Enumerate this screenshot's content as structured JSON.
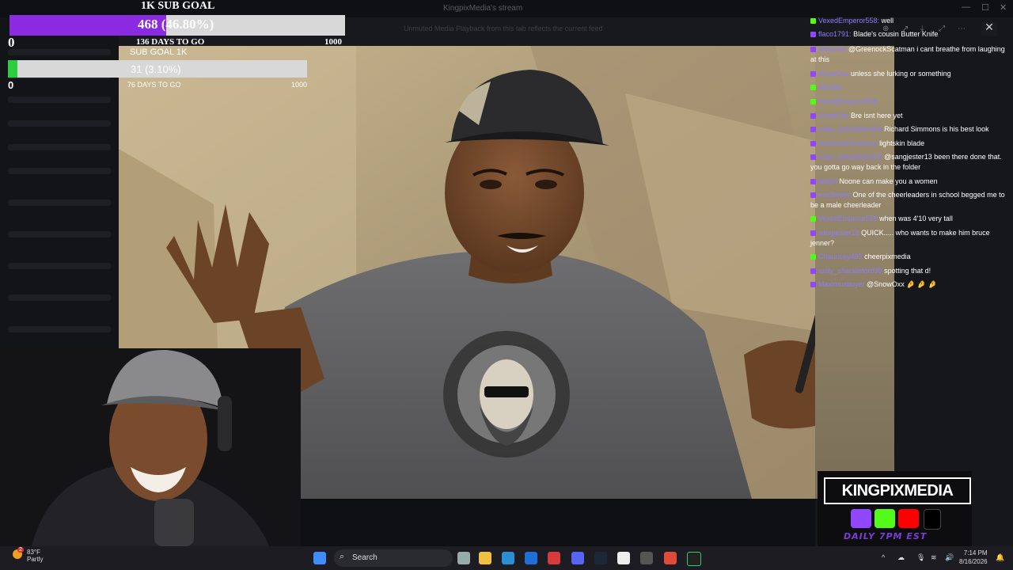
{
  "window": {
    "title": "KingpixMedia's stream"
  },
  "browser_notice": "Unmuted Media Playback from this tab reflects the current feed",
  "goal_primary": {
    "title": "1K SUB GOAL",
    "progress_text": "468 (46.80%)",
    "progress_fraction": 0.468,
    "start": "0",
    "days_to_go": "136 DAYS TO GO",
    "target": "1000",
    "fill_color": "#8a2be2"
  },
  "goal_secondary": {
    "title": "SUB GOAL 1K",
    "progress_text": "31 (3.10%)",
    "progress_fraction": 0.031,
    "start": "0",
    "days_to_go": "76 DAYS TO GO",
    "target": "1000",
    "fill_color": "#2ecc40"
  },
  "chat": {
    "messages": [
      {
        "badge": "kick",
        "user": "VexedEmperor558:",
        "text": "well"
      },
      {
        "badge": "twitch",
        "user": "flaco1791:",
        "text": "Blade's cousin Butter Knife"
      },
      {
        "badge": "twitch",
        "user": "lotbarrett",
        "text": "@GreenockScatman i cant breathe from laughing at this"
      },
      {
        "badge": "twitch",
        "user": "SnowOxx",
        "text": "unless she lurking or something"
      },
      {
        "badge": "kick",
        "user": "Ascaldi",
        "text": ""
      },
      {
        "badge": "kick",
        "user": "VexedEmperor558",
        "text": ""
      },
      {
        "badge": "twitch",
        "user": "SnowOxx",
        "text": "Bre isnt here yet"
      },
      {
        "badge": "twitch",
        "user": "rusty_shackleford99",
        "text": "Richard Simmons is his best look"
      },
      {
        "badge": "twitch",
        "user": "GreenockScatman",
        "text": "lightskin blade"
      },
      {
        "badge": "twitch",
        "user": "rusty_shackleford99",
        "text": "@sangjester13 been there done that. you gotta go way back in the folder"
      },
      {
        "badge": "twitch",
        "user": "djvtp2",
        "text": "Noone can make you a women"
      },
      {
        "badge": "twitch",
        "user": "mecheeks",
        "text": "One of the cheerleaders in school begged me to be a male cheerleader"
      },
      {
        "badge": "kick",
        "user": "VexedEmperor558",
        "text": "when was 4'10 very tall"
      },
      {
        "badge": "twitch",
        "user": "sangjester13",
        "text": "QUICK..... who wants to make him bruce jenner?"
      },
      {
        "badge": "kick",
        "user": "Chauncey493",
        "text": "cheerpixmedia"
      },
      {
        "badge": "twitch",
        "user": "rusty_shackleford99",
        "text": "spotting that d!"
      },
      {
        "badge": "twitch",
        "user": "Maximusbuyer",
        "text": "@SnowOxx 🤌 🤌 🤌"
      }
    ]
  },
  "brand": {
    "name": "KINGPIXMEDIA",
    "schedule": "DAILY 7PM EST"
  },
  "taskbar": {
    "weather_temp": "83°F",
    "weather_desc": "Partly",
    "search": "Search",
    "time": "7:14 PM",
    "date": "8/16/2026",
    "weather_badge": "2"
  },
  "colors": {
    "twitch": "#9146ff",
    "kick": "#53fc18",
    "youtube": "#ff0000",
    "chat_user": "#8a7cff"
  }
}
